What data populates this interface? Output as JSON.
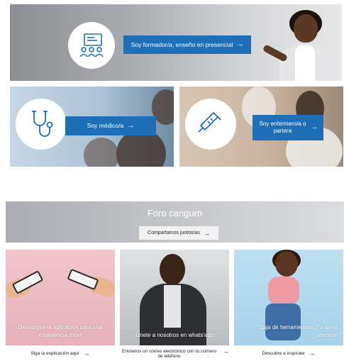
{
  "hero": {
    "cta_label": "Soy formador/a, enseño en presencial",
    "arrow": "→",
    "icon": "classroom-presentation-icon"
  },
  "cards": {
    "medico": {
      "cta_label": "Soy médico/a",
      "arrow": "→",
      "icon": "stethoscope-icon"
    },
    "enfermero": {
      "cta_label": "Soy enfermero/a o partera",
      "arrow": "→",
      "icon": "syringe-icon"
    }
  },
  "forum": {
    "title": "Foro canguro",
    "button_label": "Compartamos juntos/as",
    "arrow": "→"
  },
  "bottom_cards": [
    {
      "caption": "Descargue la aplicación para una experiencia móvil",
      "link_label": "Siga la explicación aquí",
      "arrow": "→"
    },
    {
      "caption": "¡Únete a nosotros en whats'app!",
      "link_label": "Envíanos un correo electrónico con tu número de teléfono",
      "arrow": "→"
    },
    {
      "caption": "Caja de herramientas ¡Tu arma secreta!",
      "link_label": "Descubre e inspírate",
      "arrow": "→"
    }
  ],
  "colors": {
    "accent_blue": "#1f6fb8",
    "white": "#ffffff"
  }
}
